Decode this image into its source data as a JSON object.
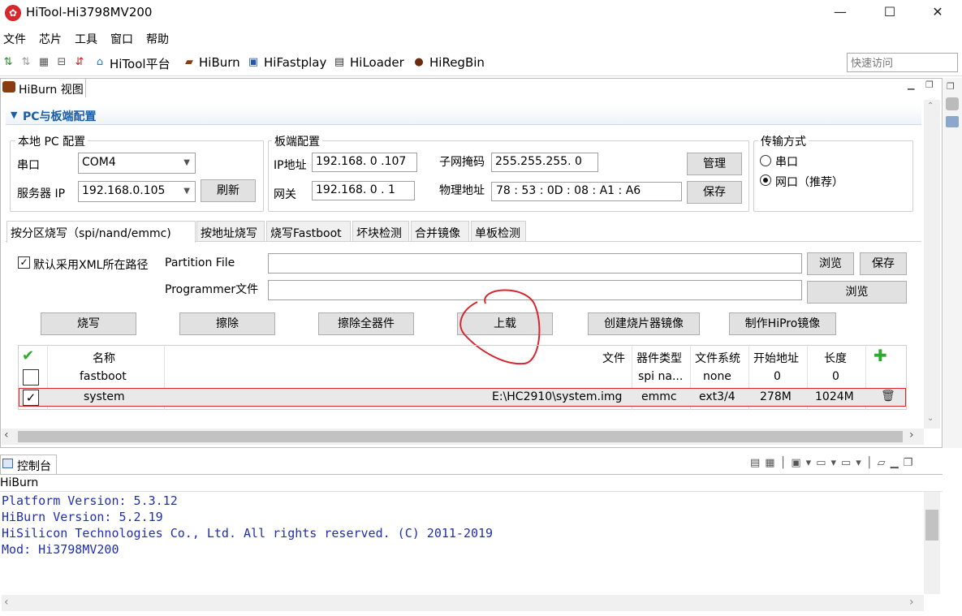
{
  "window": {
    "title": "HiTool-Hi3798MV200",
    "logo": "HiTool logo",
    "minimize": "—",
    "maximize": "☐",
    "close": "✕"
  },
  "menu": [
    "文件",
    "芯片",
    "工具",
    "窗口",
    "帮助"
  ],
  "toolbar": {
    "items": [
      "HiTool平台",
      "HiBurn",
      "HiFastplay",
      "HiLoader",
      "HiRegBin"
    ],
    "quick_access_placeholder": "快速访问"
  },
  "view": {
    "tab_label": "HiBurn 视图"
  },
  "config": {
    "section_title": "PC与板端配置",
    "local_pc": {
      "title": "本地 PC 配置",
      "serial_label": "串口",
      "serial_value": "COM4",
      "server_ip_label": "服务器 IP",
      "server_ip_value": "192.168.0.105",
      "refresh": "刷新"
    },
    "board": {
      "title": "板端配置",
      "ip_label": "IP地址",
      "ip_value": "192.168. 0 .107",
      "gateway_label": "网关",
      "gateway_value": "192.168. 0 . 1",
      "mask_label": "子网掩码",
      "mask_value": "255.255.255. 0",
      "mac_label": "物理地址",
      "mac_value": "78 : 53 : 0D : 08 : A1 : A6",
      "manage": "管理",
      "save": "保存"
    },
    "transfer": {
      "title": "传输方式",
      "serial": "串口",
      "network": "网口（推荐）"
    }
  },
  "tabs": [
    "按分区烧写（spi/nand/emmc)",
    "按地址烧写",
    "烧写Fastboot",
    "坏块检测",
    "合并镜像",
    "单板检测"
  ],
  "partition": {
    "xml_checkbox_label": "默认采用XML所在路径",
    "partition_file_label": "Partition File",
    "programmer_label": "Programmer文件",
    "browse": "浏览",
    "save": "保存",
    "browse2": "浏览"
  },
  "actions": [
    "烧写",
    "擦除",
    "擦除全器件",
    "上载",
    "创建烧片器镜像",
    "制作HiPro镜像"
  ],
  "table": {
    "headers": [
      "名称",
      "文件",
      "器件类型",
      "文件系统",
      "开始地址",
      "长度"
    ],
    "rows": [
      {
        "checked": false,
        "name": "fastboot",
        "file": "",
        "device": "spi na...",
        "fs": "none",
        "start": "0",
        "length": "0"
      },
      {
        "checked": true,
        "name": "system",
        "file": "E:\\HC2910\\system.img",
        "device": "emmc",
        "fs": "ext3/4",
        "start": "278M",
        "length": "1024M"
      }
    ]
  },
  "console": {
    "tab_label": "控制台",
    "source": "HiBurn",
    "lines": [
      "Platform Version: 5.3.12",
      "HiBurn Version: 5.2.19",
      "HiSilicon Technologies Co., Ltd. All rights reserved. (C) 2011-2019",
      "Mod: Hi3798MV200"
    ]
  },
  "colors": {
    "accent": "#1a5ea8",
    "console_text": "#1f2fae",
    "highlight_red": "#d7262e",
    "add_green": "#2eaa2e"
  }
}
